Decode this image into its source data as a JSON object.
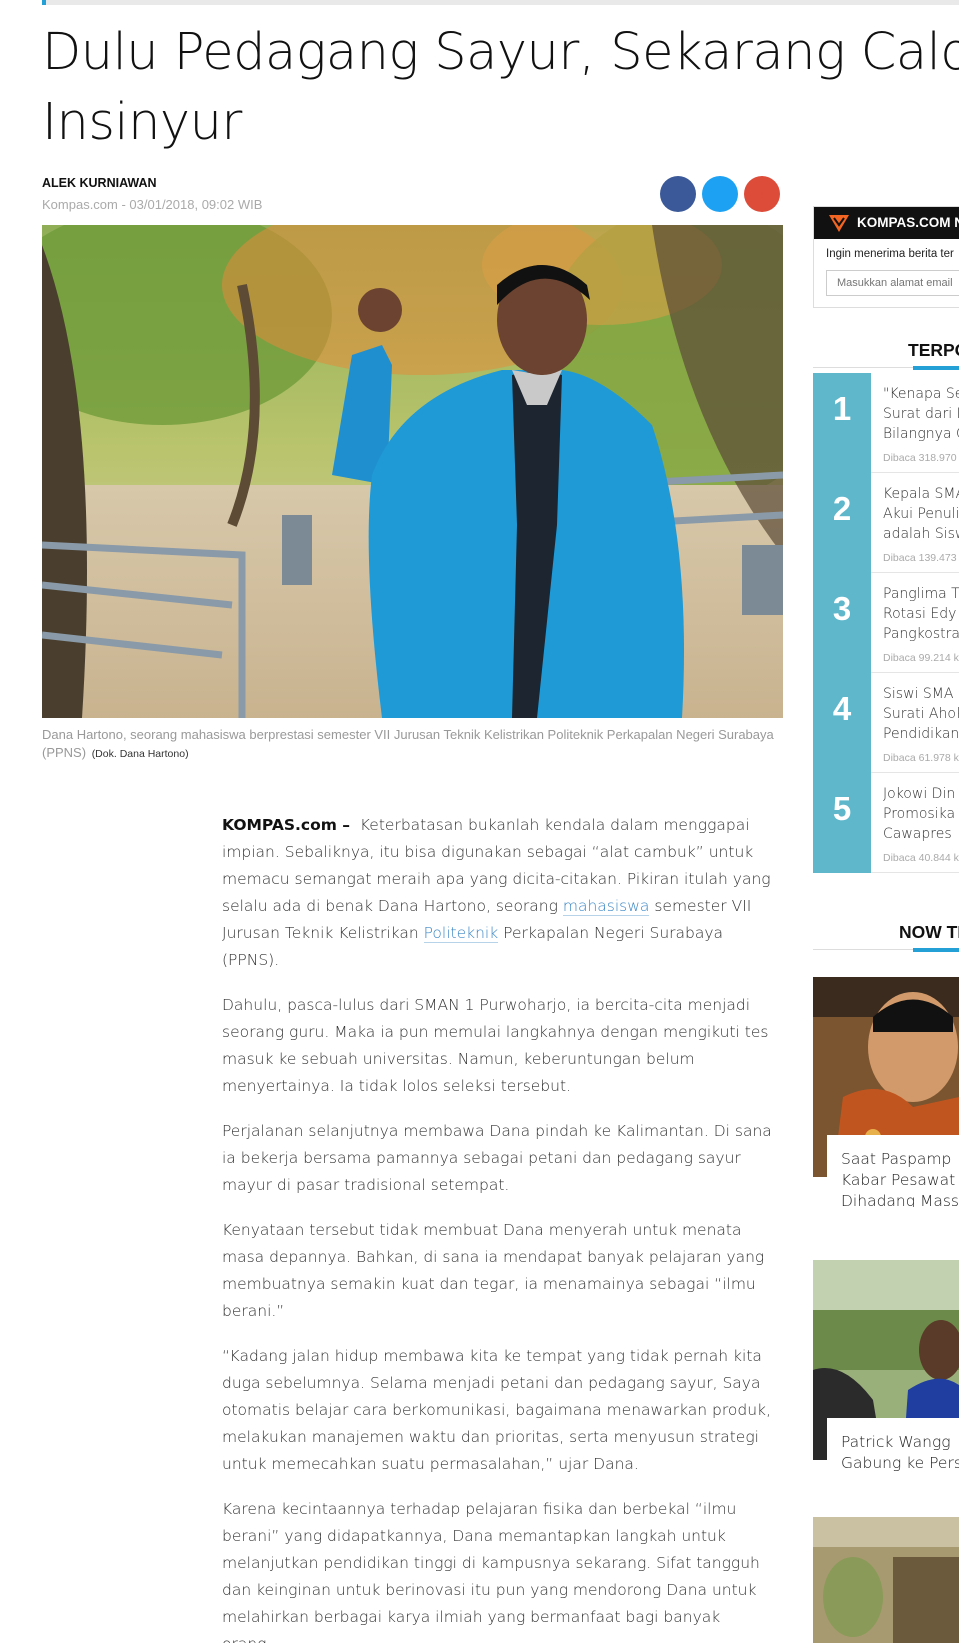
{
  "article": {
    "title_line1": "Dulu Pedagang Sayur, Sekarang Calon",
    "title_line2": "Insinyur",
    "author": "ALEK KURNIAWAN",
    "dateline": "Kompas.com - 03/01/2018, 09:02 WIB",
    "caption": "Dana Hartono, seorang mahasiswa berprestasi semester VII Jurusan Teknik Kelistrikan Politeknik Perkapalan Negeri Surabaya (PPNS)",
    "caption_credit": "(Dok. Dana Hartono)",
    "lead_source": "KOMPAS.com",
    "lead_dash": " –",
    "p1_a": "Keterbatasan bukanlah kendala dalam menggapai impian. Sebaliknya, itu bisa digunakan sebagai “alat cambuk” untuk memacu semangat meraih apa yang dicita-citakan. Pikiran itulah yang selalu ada di benak Dana Hartono, seorang ",
    "p1_link1": "mahasiswa",
    "p1_b": " semester VII Jurusan Teknik Kelistrikan ",
    "p1_link2": "Politeknik",
    "p1_c": " Perkapalan Negeri Surabaya (PPNS).",
    "p2": "Dahulu, pasca-lulus dari SMAN 1 Purwoharjo, ia bercita-cita menjadi seorang guru. Maka ia pun memulai langkahnya dengan mengikuti tes masuk ke sebuah universitas. Namun, keberuntungan belum menyertainya. Ia tidak lolos seleksi tersebut.",
    "p3": "Perjalanan selanjutnya membawa Dana pindah ke Kalimantan. Di sana ia bekerja bersama pamannya sebagai petani dan pedagang sayur mayur di pasar tradisional setempat.",
    "p4": "Kenyataan tersebut tidak membuat Dana menyerah untuk menata masa depannya. Bahkan, di sana ia mendapat banyak pelajaran yang membuatnya semakin kuat dan tegar, ia menamainya sebagai “ilmu berani.”",
    "p5": "“Kadang jalan hidup membawa kita ke tempat yang tidak pernah kita duga sebelumnya. Selama menjadi petani dan pedagang sayur, Saya otomatis belajar cara berkomunikasi, bagaimana menawarkan produk, melakukan manajemen waktu dan prioritas, serta menyusun strategi untuk memecahkan suatu permasalahan,” ujar Dana.",
    "p6": "Karena kecintaannya terhadap pelajaran fisika dan berbekal “ilmu berani” yang didapatkannya, Dana memantapkan langkah untuk melanjutkan pendidikan tinggi di kampusnya sekarang. Sifat tangguh dan keinginan untuk berinovasi itu pun yang mendorong Dana untuk melahirkan berbagai karya ilmiah yang bermanfaat bagi banyak orang."
  },
  "share": {
    "facebook": "facebook-icon",
    "twitter": "twitter-icon",
    "googleplus": "google-plus-icon"
  },
  "newsletter": {
    "title": "KOMPAS.COM N",
    "text": "Ingin menerima berita ter",
    "placeholder": "Masukkan alamat email"
  },
  "popular": {
    "heading": "TERPO",
    "items": [
      {
        "num": "1",
        "l1": "\"Kenapa Se",
        "l2": "Surat dari P",
        "l3": "Bilangnya C",
        "read": "Dibaca 318.970"
      },
      {
        "num": "2",
        "l1": "Kepala SMA",
        "l2": "Akui Penuli",
        "l3": "adalah Sisw",
        "read": "Dibaca 139.473"
      },
      {
        "num": "3",
        "l1": "Panglima T",
        "l2": "Rotasi Edy",
        "l3": "Pangkostra",
        "read": "Dibaca 99.214 k"
      },
      {
        "num": "4",
        "l1": "Siswi SMA",
        "l2": "Surati Ahok",
        "l3": "Pendidikan",
        "read": "Dibaca 61.978 k"
      },
      {
        "num": "5",
        "l1": "Jokowi Din",
        "l2": "Promosika",
        "l3": "Cawapres",
        "read": "Dibaca 40.844 k"
      }
    ]
  },
  "trending": {
    "heading": "NOW TR",
    "items": [
      {
        "l1": "Saat Paspamp",
        "l2": "Kabar Pesawat",
        "l3": "Dihadang Mass"
      },
      {
        "l1": "Patrick Wangg",
        "l2": "Gabung ke Pers",
        "l3": ""
      }
    ]
  },
  "colors": {
    "accent": "#24a0d6",
    "popular_num_bg": "#5fb7cc",
    "link": "#3a86c4"
  }
}
